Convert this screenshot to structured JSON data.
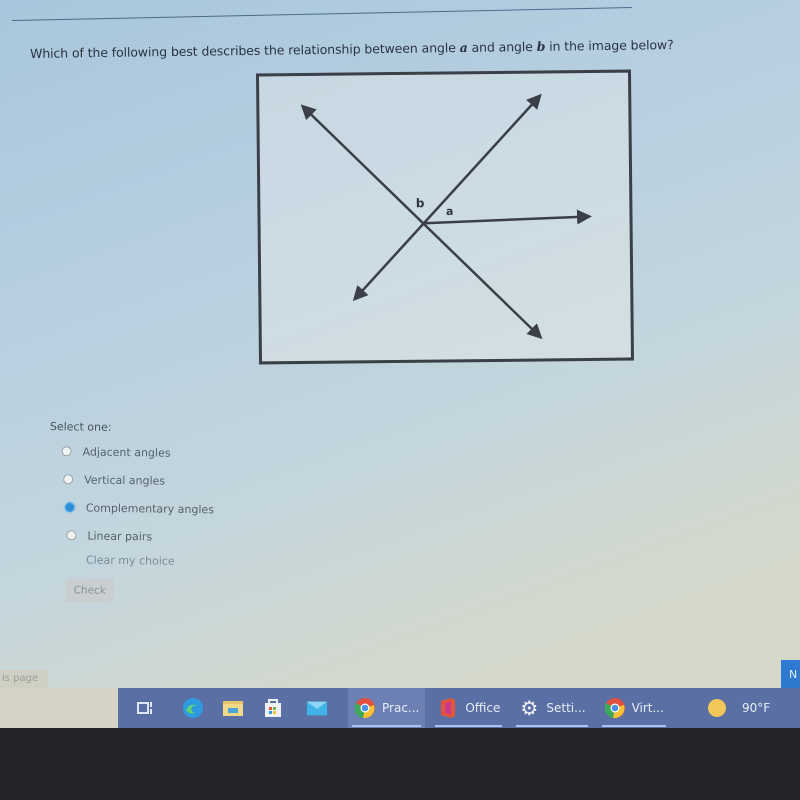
{
  "question": {
    "prefix": "Which of the following best describes the relationship between angle ",
    "angle_a": "a",
    "middle": " and angle ",
    "angle_b": "b",
    "suffix": " in the image below?"
  },
  "figure": {
    "label_a": "a",
    "label_b": "b"
  },
  "answers": {
    "select_label": "Select one:",
    "options": [
      {
        "label": "Adjacent angles",
        "selected": false
      },
      {
        "label": "Vertical angles",
        "selected": false
      },
      {
        "label": "Complementary angles",
        "selected": true
      },
      {
        "label": "Linear pairs",
        "selected": false
      }
    ],
    "clear_label": "Clear my choice",
    "check_label": "Check"
  },
  "footer": {
    "left_text": "is page",
    "next_label": "N"
  },
  "taskbar": {
    "items": [
      {
        "icon": "task-view-icon",
        "label": ""
      },
      {
        "icon": "edge-icon",
        "label": ""
      },
      {
        "icon": "file-explorer-icon",
        "label": ""
      },
      {
        "icon": "store-icon",
        "label": ""
      },
      {
        "icon": "mail-icon",
        "label": ""
      },
      {
        "icon": "chrome-icon",
        "label": "Prac..."
      },
      {
        "icon": "office-icon",
        "label": "Office"
      },
      {
        "icon": "settings-icon",
        "label": "Setti..."
      },
      {
        "icon": "chrome-icon",
        "label": "Virt..."
      }
    ],
    "weather": {
      "icon": "sun-icon",
      "temp": "90°F"
    }
  }
}
